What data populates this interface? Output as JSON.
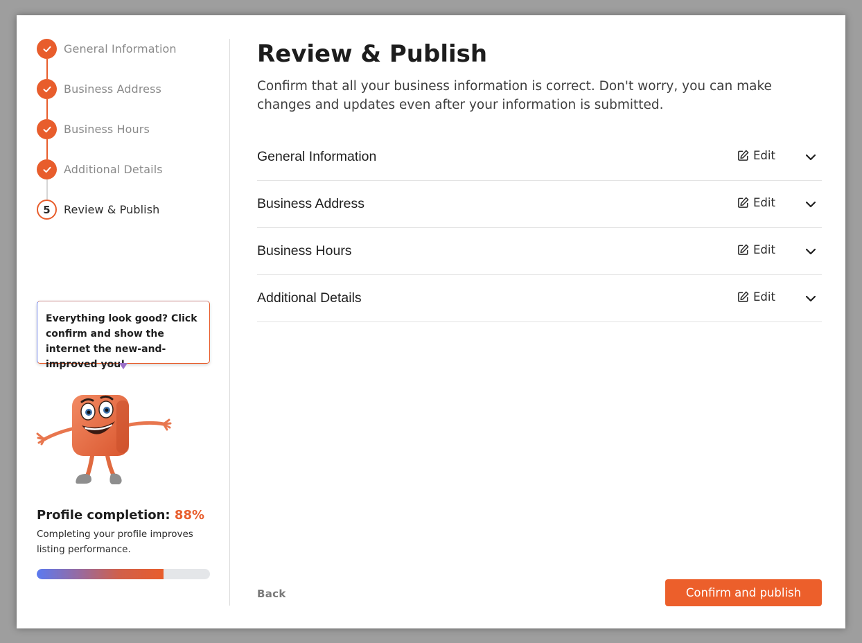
{
  "colors": {
    "accent": "#e85d2c",
    "button": "#ec5f2b",
    "text_dark": "#1d1d1d",
    "text_muted": "#8a8a8a",
    "divider": "#e3e3e3"
  },
  "sidebar": {
    "steps": [
      {
        "label": "General Information",
        "status": "done",
        "icon": "check-icon"
      },
      {
        "label": "Business Address",
        "status": "done",
        "icon": "check-icon"
      },
      {
        "label": "Business Hours",
        "status": "done",
        "icon": "check-icon"
      },
      {
        "label": "Additional Details",
        "status": "done",
        "icon": "check-icon"
      },
      {
        "label": "Review & Publish",
        "status": "current",
        "number": "5"
      }
    ],
    "bubble_text": "Everything look good? Click confirm and show the internet the new-and-improved you!",
    "mascot": "orange-cube-mascot",
    "completion": {
      "title": "Profile completion:",
      "percent_label": "88%",
      "percent_value": 0.88,
      "description": "Completing your profile improves listing performance.",
      "bar_fill_fraction": 0.73
    }
  },
  "main": {
    "title": "Review & Publish",
    "subtitle": "Confirm that all your business information is correct. Don't worry, you can make changes and updates even after your information is submitted.",
    "sections": [
      {
        "name": "General Information",
        "edit_label": "Edit"
      },
      {
        "name": "Business Address",
        "edit_label": "Edit"
      },
      {
        "name": "Business Hours",
        "edit_label": "Edit"
      },
      {
        "name": "Additional Details",
        "edit_label": "Edit"
      }
    ],
    "back_label": "Back",
    "confirm_label": "Confirm and publish"
  }
}
